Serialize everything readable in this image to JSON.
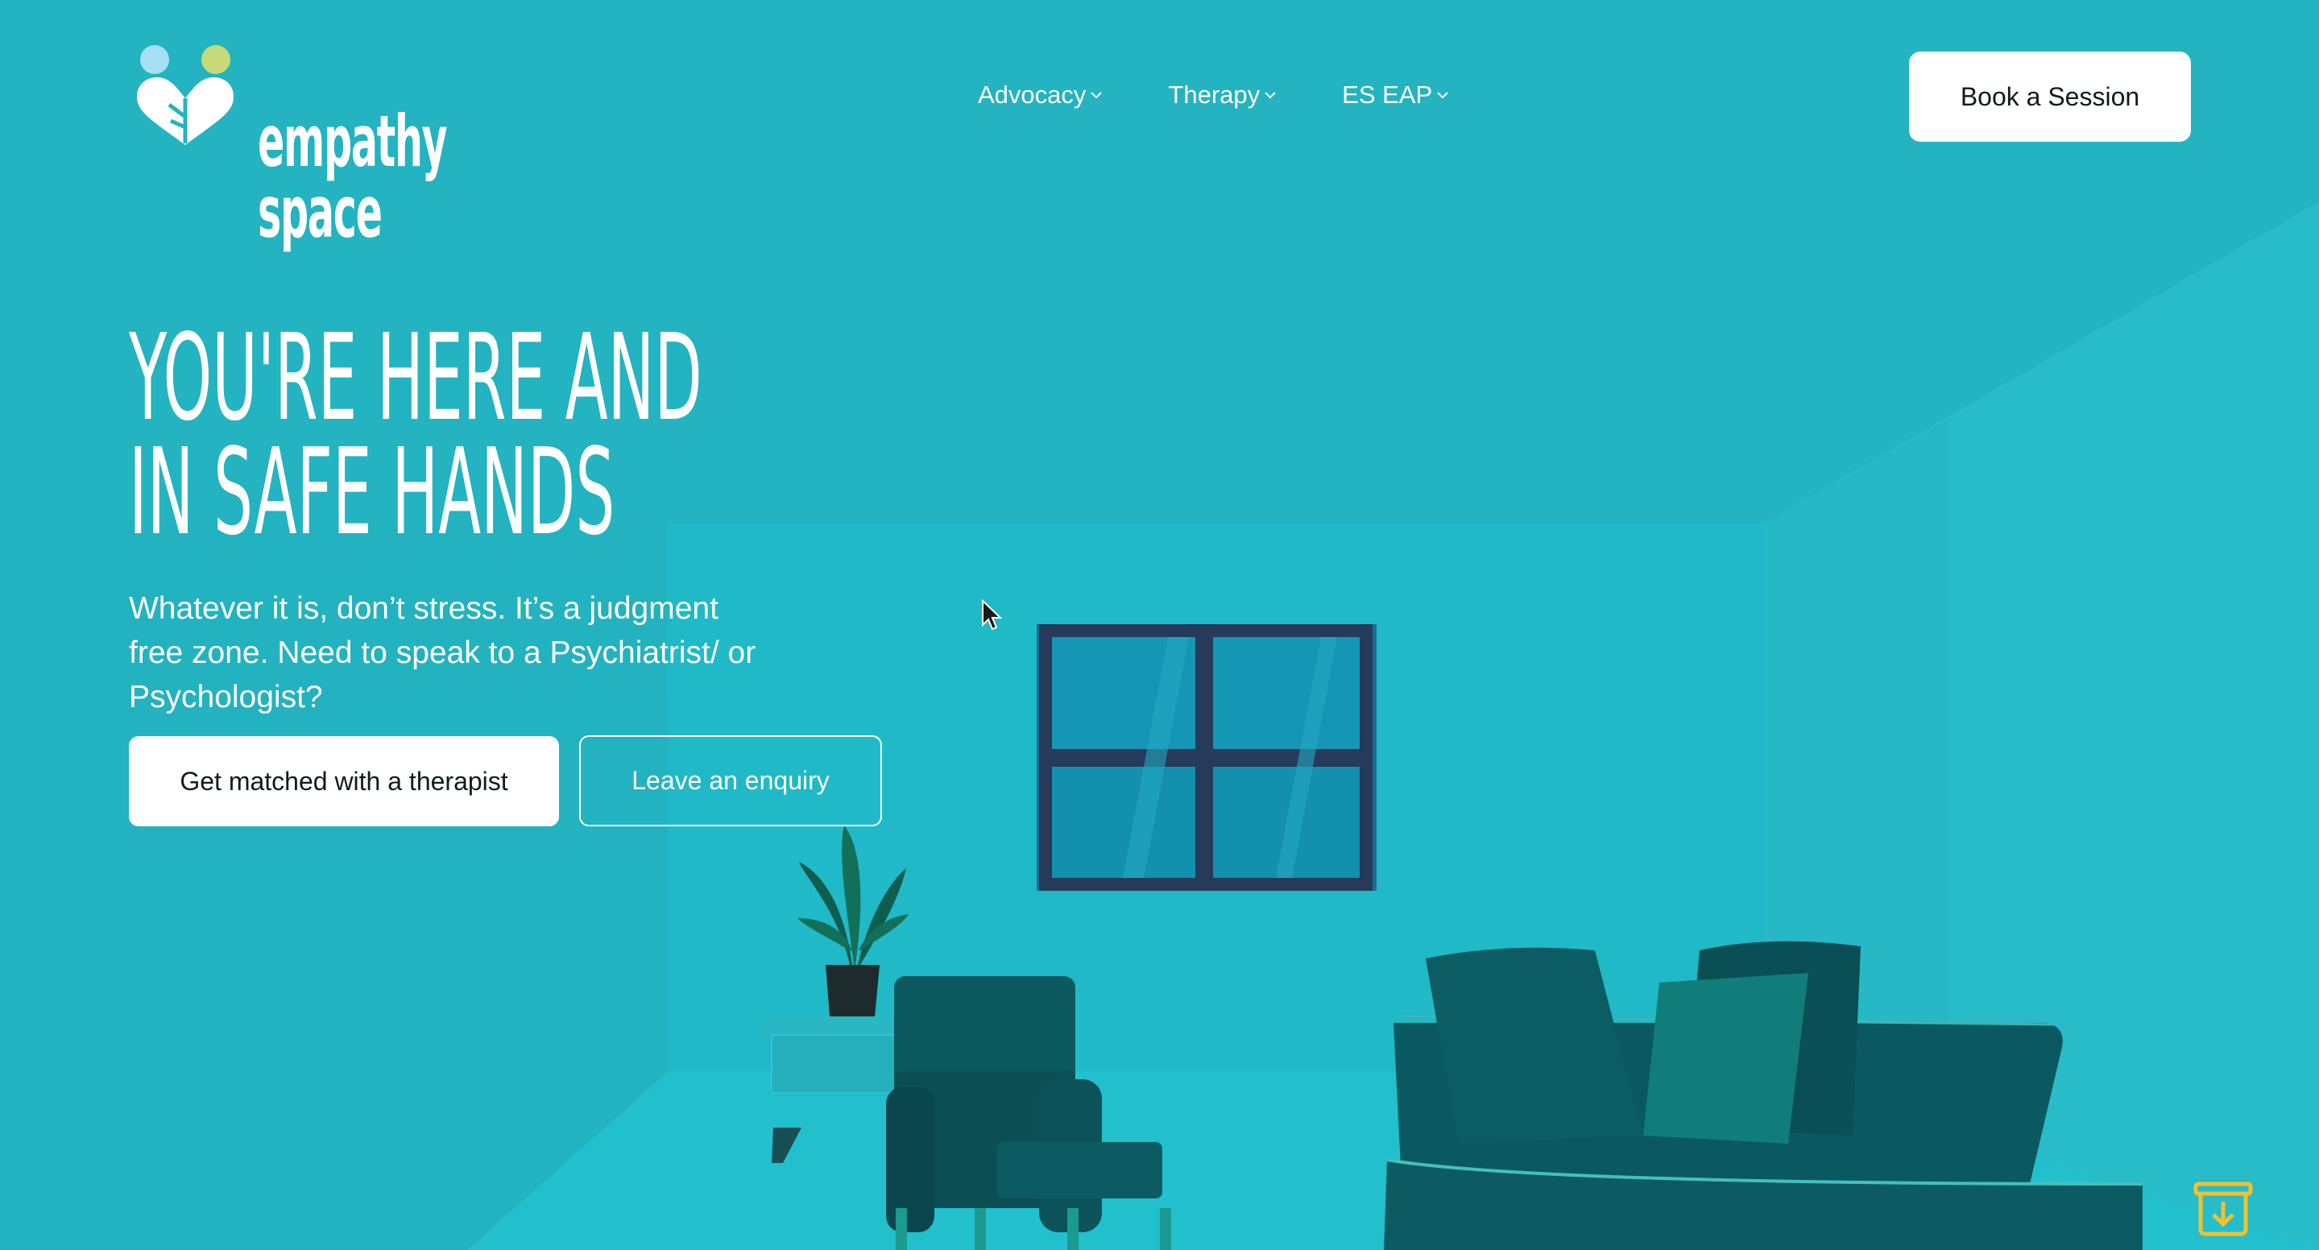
{
  "brand": {
    "name": "empathy space",
    "colors": {
      "background": "#24b3c0",
      "logo_blue": "#a6dff3",
      "logo_yellow": "#c8d97a",
      "furniture": "#0c5f66",
      "download_icon": "#f2c12e"
    }
  },
  "nav": {
    "items": [
      {
        "label": "Advocacy",
        "icon": "chevron-down-icon"
      },
      {
        "label": "Therapy",
        "icon": "chevron-down-icon"
      },
      {
        "label": "ES EAP",
        "icon": "chevron-down-icon"
      }
    ]
  },
  "header": {
    "book_label": "Book a Session"
  },
  "hero": {
    "title_line1": "YOU'RE HERE AND",
    "title_line2": "IN SAFE HANDS",
    "subtitle": "Whatever it is, don’t stress. It’s a judgment free zone. Need to speak to a Psychiatrist/ or Psychologist?",
    "primary_button": "Get matched with a therapist",
    "secondary_button": "Leave an enquiry"
  },
  "icons": {
    "cursor": "pointer-arrow-icon",
    "download": "download-box-icon"
  }
}
